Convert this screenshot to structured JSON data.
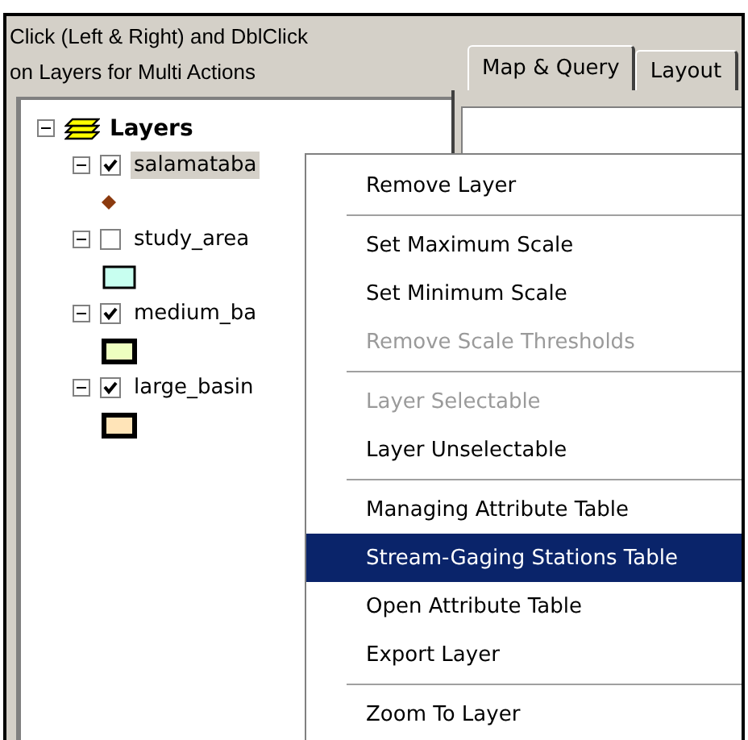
{
  "header": {
    "instructions": [
      "Click (Left & Right) and DblClick",
      "on Layers for Multi Actions"
    ]
  },
  "tabs": [
    {
      "label": "Map & Query",
      "selected": true
    },
    {
      "label": "Layout",
      "selected": false
    }
  ],
  "tree": {
    "root": {
      "label": "Layers",
      "expanded": true
    },
    "layers": [
      {
        "label": "salamataba",
        "checked": true,
        "expanded": true,
        "selected": true,
        "kind": "point",
        "color": "#8b3a0e"
      },
      {
        "label": "study_area",
        "checked": false,
        "expanded": true,
        "selected": false,
        "kind": "polygon",
        "color": "#c8fff0"
      },
      {
        "label": "medium_ba",
        "checked": true,
        "expanded": true,
        "selected": false,
        "kind": "polygon",
        "color": "#eeffc0"
      },
      {
        "label": "large_basin",
        "checked": true,
        "expanded": true,
        "selected": false,
        "kind": "polygon",
        "color": "#ffe4b8"
      }
    ]
  },
  "context_menu": [
    {
      "kind": "item",
      "label": "Remove Layer",
      "disabled": false,
      "selected": false
    },
    {
      "kind": "separator"
    },
    {
      "kind": "item",
      "label": "Set Maximum Scale",
      "disabled": false,
      "selected": false
    },
    {
      "kind": "item",
      "label": "Set Minimum Scale",
      "disabled": false,
      "selected": false
    },
    {
      "kind": "item",
      "label": "Remove Scale Thresholds",
      "disabled": true,
      "selected": false
    },
    {
      "kind": "separator"
    },
    {
      "kind": "item",
      "label": "Layer Selectable",
      "disabled": true,
      "selected": false
    },
    {
      "kind": "item",
      "label": "Layer Unselectable",
      "disabled": false,
      "selected": false
    },
    {
      "kind": "separator"
    },
    {
      "kind": "item",
      "label": "Managing Attribute Table",
      "disabled": false,
      "selected": false
    },
    {
      "kind": "item",
      "label": "Stream-Gaging Stations Table",
      "disabled": false,
      "selected": true
    },
    {
      "kind": "item",
      "label": "Open Attribute Table",
      "disabled": false,
      "selected": false
    },
    {
      "kind": "item",
      "label": "Export Layer",
      "disabled": false,
      "selected": false
    },
    {
      "kind": "separator"
    },
    {
      "kind": "item",
      "label": "Zoom To Layer",
      "disabled": false,
      "selected": false
    }
  ]
}
